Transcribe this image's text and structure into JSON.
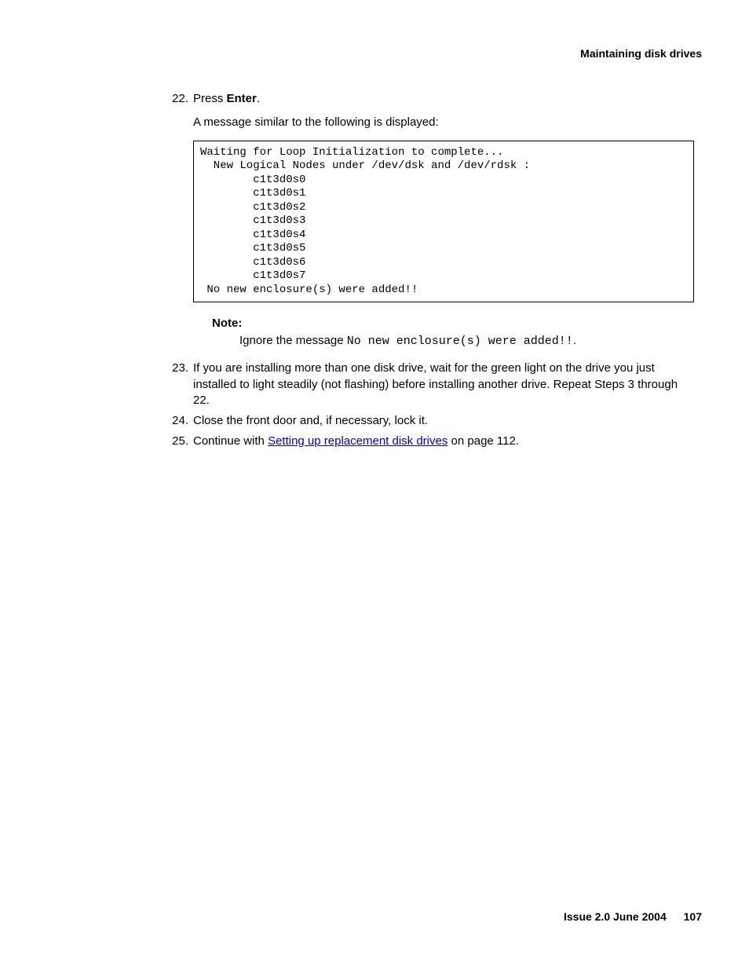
{
  "header": {
    "title": "Maintaining disk drives"
  },
  "steps": {
    "s22": {
      "num": "22.",
      "text_before": "Press ",
      "text_bold": "Enter",
      "text_after": ".",
      "sub": "A message similar to the following is displayed:"
    },
    "code": "Waiting for Loop Initialization to complete...\n  New Logical Nodes under /dev/dsk and /dev/rdsk :\n        c1t3d0s0\n        c1t3d0s1\n        c1t3d0s2\n        c1t3d0s3\n        c1t3d0s4\n        c1t3d0s5\n        c1t3d0s6\n        c1t3d0s7\n No new enclosure(s) were added!!",
    "note": {
      "label": "Note:",
      "body_before": "Ignore the message ",
      "body_mono": "No new enclosure(s) were added!!",
      "body_after": "."
    },
    "s23": {
      "num": "23.",
      "text": "If you are installing more than one disk drive, wait for the green light on the drive you just installed to light steadily (not flashing) before installing another drive. Repeat Steps 3 through 22."
    },
    "s24": {
      "num": "24.",
      "text": "Close the front door and, if necessary, lock it."
    },
    "s25": {
      "num": "25.",
      "text_before": "Continue with ",
      "link": "Setting up replacement disk drives",
      "text_after": " on page 112."
    }
  },
  "footer": {
    "issue": "Issue 2.0   June 2004",
    "page": "107"
  }
}
